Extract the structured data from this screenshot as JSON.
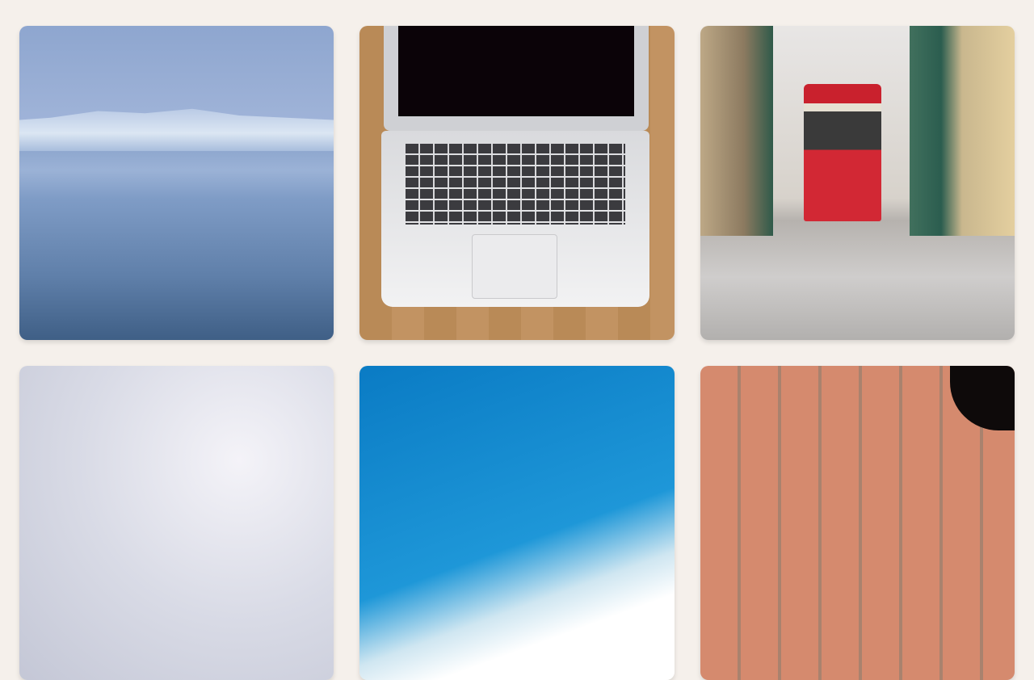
{
  "page": {
    "background_color": "#f5f0eb"
  },
  "gallery": {
    "items": [
      {
        "dominant_color": "#7f9cc6"
      },
      {
        "dominant_color": "#c29362"
      },
      {
        "dominant_color": "#d22834"
      },
      {
        "dominant_color": "#d9dbe6"
      },
      {
        "dominant_color": "#1e97d8"
      },
      {
        "dominant_color": "#d58a6e"
      }
    ]
  }
}
